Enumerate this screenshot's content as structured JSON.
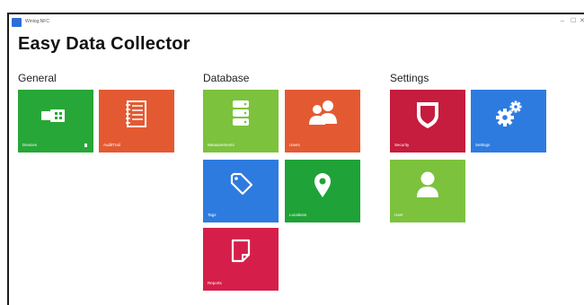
{
  "window": {
    "title": "Winlog.NFC",
    "controls": [
      "–",
      "☐",
      "✕"
    ]
  },
  "app": {
    "title": "Easy Data Collector"
  },
  "sections": {
    "general": "General",
    "database": "Database",
    "settings": "Settings"
  },
  "tiles": {
    "devices": {
      "label": "Devices",
      "color": "#27a737",
      "icon": "usb-icon"
    },
    "audit_trail": {
      "label": "AuditTrail",
      "color": "#e35a32",
      "icon": "notepad-icon"
    },
    "measurements": {
      "label": "Measurements",
      "color": "#7cc23d",
      "icon": "database-icon"
    },
    "users": {
      "label": "Users",
      "color": "#e35a32",
      "icon": "users-icon"
    },
    "tags": {
      "label": "Tags",
      "color": "#2e7be0",
      "icon": "tag-icon"
    },
    "locations": {
      "label": "Locations",
      "color": "#1fa238",
      "icon": "location-pin-icon"
    },
    "reports": {
      "label": "Reports",
      "color": "#d51f4a",
      "icon": "report-page-icon"
    },
    "security": {
      "label": "Security",
      "color": "#c61c3d",
      "icon": "shield-icon"
    },
    "settings": {
      "label": "Settings",
      "color": "#2e7be0",
      "icon": "gears-icon"
    },
    "user": {
      "label": "User",
      "color": "#7cc23d",
      "icon": "user-icon"
    }
  }
}
